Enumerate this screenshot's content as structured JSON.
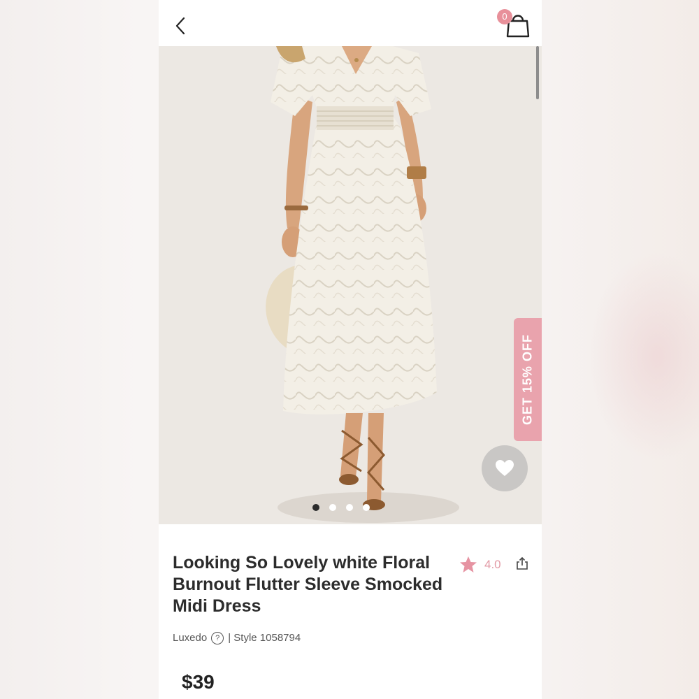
{
  "header": {
    "cart_count": "0"
  },
  "gallery": {
    "promo_label": "GET 15% OFF",
    "image_count": 4,
    "active_index": 0
  },
  "product": {
    "title": "Looking So Lovely white Floral Burnout Flutter Sleeve Smocked Midi Dress",
    "rating": "4.0",
    "brand": "Luxedo",
    "style": "| Style 1058794",
    "price": "$39"
  },
  "icons": {
    "back": "chevron-left-icon",
    "cart": "shopping-bag-icon",
    "favorite": "heart-icon",
    "rating": "star-icon",
    "share": "share-icon",
    "help": "question-circle-icon"
  },
  "colors": {
    "accent_pink": "#e9a3ad",
    "badge_pink": "#e8909a",
    "rating_pink": "#e29aa5",
    "photo_background": "#ece8e3"
  }
}
